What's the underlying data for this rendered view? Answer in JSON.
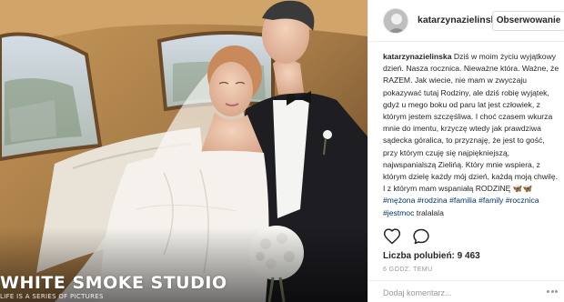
{
  "photo": {
    "watermark": "WHITE SMOKE STUDIO",
    "watermark_tagline": "LIFE IS A SERIES OF PICTURES"
  },
  "post": {
    "username": "katarzynazielinska",
    "follow_label": "Obserwowanie",
    "caption_user": "katarzynazielinska",
    "caption_text": "Dziś w moim życiu wyjątkowy dzień. Nasza rocznica. Nieważne która. Ważne, że RAZEM. Jak wiecie, nie mam w zwyczaju pokazywać tutaj Rodziny, ale dziś robię wyjątek, gdyż u mego boku od paru lat jest człowiek, z którym jestem szczęśliwa. I choć czasem wkurza mnie do imentu, krzyczę wtedy jak prawdziwa sądecka góralica, to przyznaję, że jest to gość, przy którym czuję się najpiękniejszą, najwspanialszą Zielińą. Który mnie wspiera, z którym dzielę każdy mój dzień, każdą moją chwilę. I z którym mam wspaniałą RODZINĘ",
    "caption_emoji": "🦋🦋",
    "hashtags": [
      "#mężona",
      "#rodzina",
      "#familia",
      "#family",
      "#rocznica",
      "#jestmoc"
    ],
    "caption_end": "tralalala",
    "likes_label": "Liczba polubień:",
    "likes_count": "9 463",
    "time_ago": "6 GODZ. TEMU",
    "comment_placeholder": "Dodaj komentarz..."
  },
  "icons": {
    "like": "heart-outline-icon",
    "comment": "speech-bubble-icon",
    "more": "more-options-icon",
    "avatar": "profile-avatar"
  }
}
